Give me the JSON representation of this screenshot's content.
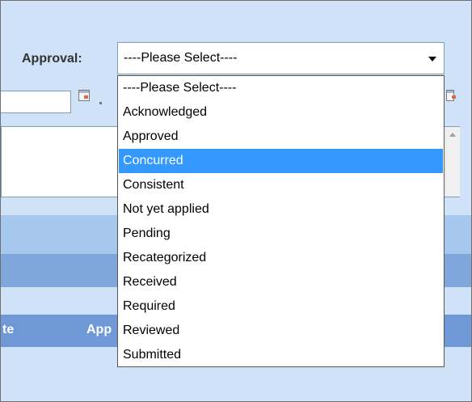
{
  "approval": {
    "label": "Approval:",
    "selected_value": "----Please Select----",
    "options": [
      "----Please Select----",
      "Acknowledged",
      "Approved",
      "Concurred",
      "Consistent",
      "Not yet applied",
      "Pending",
      "Recategorized",
      "Received",
      "Required",
      "Reviewed",
      "Submitted"
    ],
    "highlighted_option": "Concurred"
  },
  "table_header": {
    "col_te": "te",
    "col_app": "App"
  },
  "colors": {
    "panel_bg": "#cfe2f7",
    "highlight": "#3399ff",
    "header_row": "#6f99d6"
  },
  "icons": [
    "calendar-icon",
    "chevron-down-icon"
  ]
}
